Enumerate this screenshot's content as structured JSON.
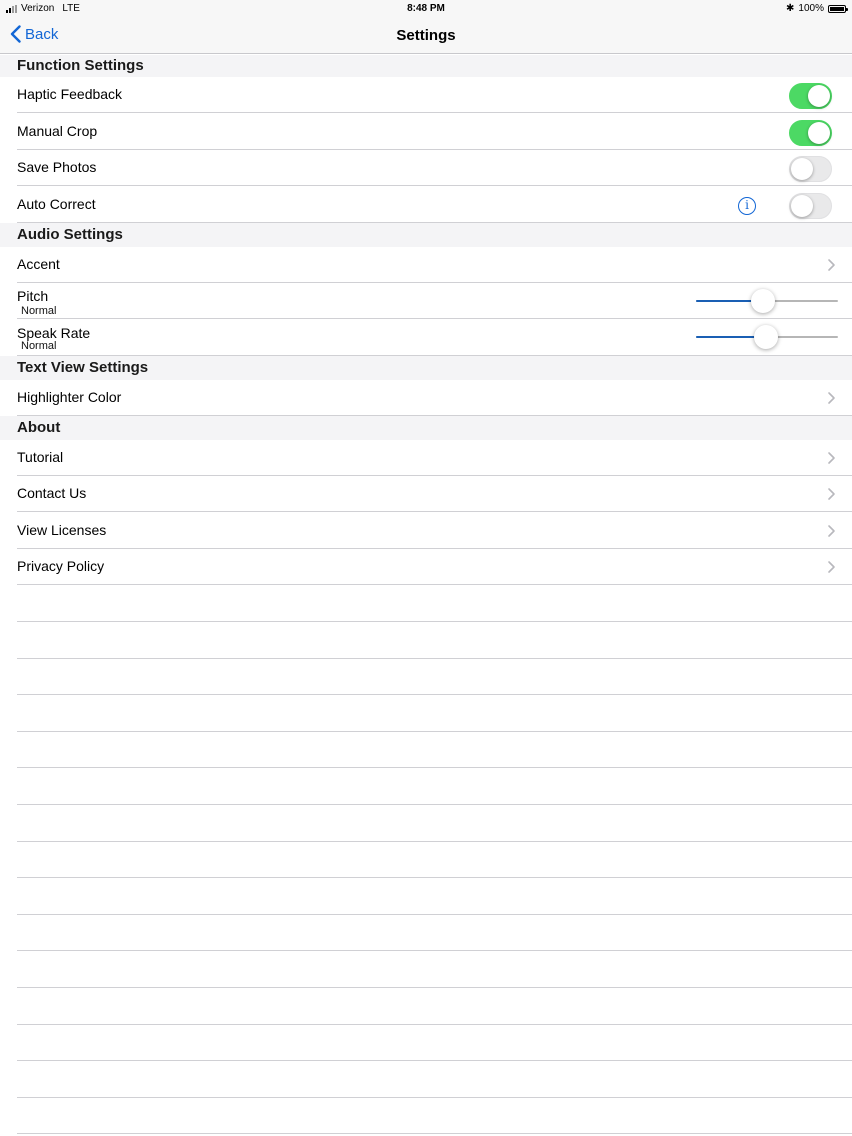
{
  "status_bar": {
    "carrier": "Verizon",
    "network": "LTE",
    "time": "8:48 PM",
    "battery": "100%"
  },
  "nav": {
    "back_label": "Back",
    "title": "Settings"
  },
  "sections": {
    "function": {
      "title": "Function Settings",
      "haptic": {
        "label": "Haptic Feedback",
        "on": true
      },
      "manual_crop": {
        "label": "Manual Crop",
        "on": true
      },
      "save_photos": {
        "label": "Save Photos",
        "on": false
      },
      "auto_correct": {
        "label": "Auto Correct",
        "on": false
      }
    },
    "audio": {
      "title": "Audio Settings",
      "accent": {
        "label": "Accent"
      },
      "pitch": {
        "label": "Pitch",
        "value_label": "Normal",
        "slider_fraction": 0.47
      },
      "speak_rate": {
        "label": "Speak Rate",
        "value_label": "Normal",
        "slider_fraction": 0.49
      }
    },
    "text_view": {
      "title": "Text View Settings",
      "highlighter": {
        "label": "Highlighter Color"
      }
    },
    "about": {
      "title": "About",
      "tutorial": {
        "label": "Tutorial"
      },
      "contact": {
        "label": "Contact Us"
      },
      "licenses": {
        "label": "View Licenses"
      },
      "privacy": {
        "label": "Privacy Policy"
      }
    }
  },
  "colors": {
    "accent": "#1266d5",
    "toggle_on": "#4cd964",
    "slider_fill": "#1a5fb4"
  }
}
